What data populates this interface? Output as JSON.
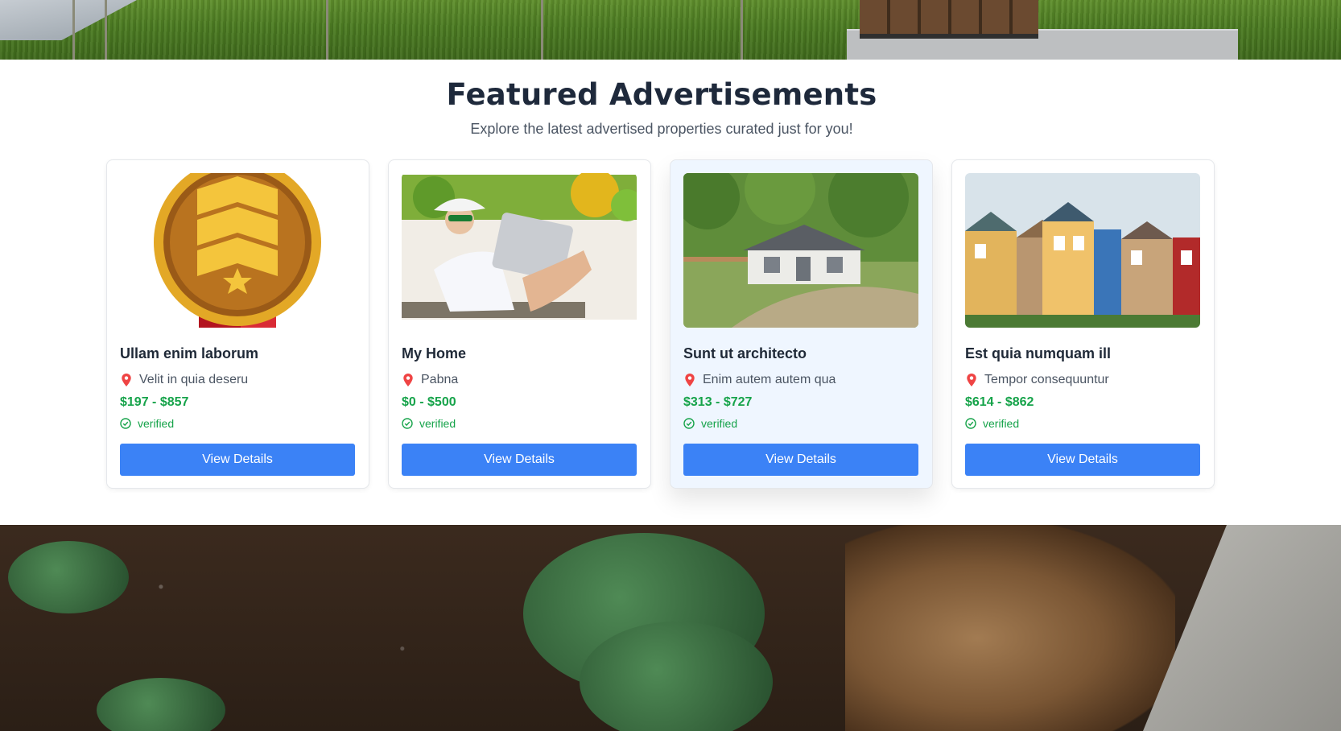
{
  "section": {
    "title": "Featured Advertisements",
    "subtitle": "Explore the latest advertised properties curated just for you!"
  },
  "cards": [
    {
      "image_alt": "medal-image",
      "title": "Ullam enim laborum",
      "location": "Velit in quia deseru",
      "price": "$197 - $857",
      "status": "verified",
      "button": "View Details"
    },
    {
      "image_alt": "man-laptop-image",
      "title": "My Home",
      "location": "Pabna",
      "price": "$0 - $500",
      "status": "verified",
      "button": "View Details"
    },
    {
      "image_alt": "house-image",
      "title": "Sunt ut architecto",
      "location": "Enim autem autem qua",
      "price": "$313 - $727",
      "status": "verified",
      "button": "View Details"
    },
    {
      "image_alt": "row-houses-image",
      "title": "Est quia numquam ill",
      "location": "Tempor consequuntur",
      "price": "$614 - $862",
      "status": "verified",
      "button": "View Details"
    }
  ],
  "colors": {
    "accent": "#3b82f6",
    "price": "#16a34a",
    "pin": "#ef4444",
    "hover_card": "#eff6ff"
  }
}
